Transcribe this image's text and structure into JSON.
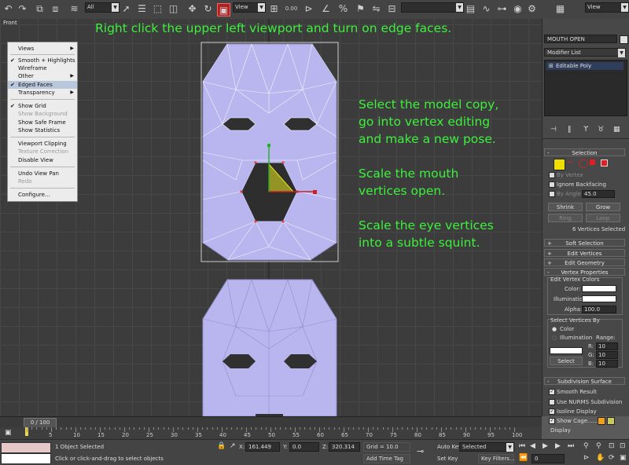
{
  "toolbar": {
    "selection_filter": "All",
    "ref_coord": "View",
    "ref_coord_2": "View",
    "spinner_value": "0.00",
    "icons": [
      "undo-icon",
      "redo-icon",
      "link-icon",
      "unlink-icon",
      "bind-space-warp-icon",
      "select-icon",
      "select-by-name-icon",
      "rect-select-icon",
      "window-crossing-icon",
      "move-icon",
      "rotate-icon",
      "scale-icon",
      "pivot-icon",
      "snap-icon",
      "angle-snap-icon",
      "percent-snap-icon",
      "spinner-snap-icon",
      "named-sets-icon",
      "mirror-icon",
      "align-icon",
      "layer-icon",
      "curve-editor-icon",
      "schematic-icon",
      "material-editor-icon",
      "render-setup-icon",
      "render-icon"
    ]
  },
  "viewport": {
    "label": "Front",
    "instructions": {
      "top": "Right click the upper left viewport and turn on edge faces.",
      "right": [
        "Select the model copy,",
        "go into vertex editing",
        "and make a new pose.",
        "",
        "Scale the mouth",
        "vertices open.",
        "",
        "Scale the eye vertices",
        "into a subtle squint."
      ]
    },
    "colors": {
      "face_fill": "#b9b6ef",
      "instruction_text": "#3cf03c",
      "gizmo_yellow": "#e8e820",
      "gizmo_red": "#cc2020",
      "gizmo_green": "#20b020"
    }
  },
  "context_menu": {
    "items": [
      {
        "label": "Views",
        "submenu": true
      },
      {
        "label": "Smooth + Highlights",
        "checked": true
      },
      {
        "label": "Wireframe"
      },
      {
        "label": "Other",
        "submenu": true
      },
      {
        "label": "Edged Faces",
        "checked": true,
        "highlighted": true
      },
      {
        "label": "Transparency",
        "submenu": true
      },
      {
        "label": "Show Grid",
        "checked": true
      },
      {
        "label": "Show Background",
        "disabled": true
      },
      {
        "label": "Show Safe Frame"
      },
      {
        "label": "Show Statistics"
      },
      {
        "label": "Viewport Clipping"
      },
      {
        "label": "Texture Correction",
        "disabled": true
      },
      {
        "label": "Disable View"
      },
      {
        "label": "Undo View Pan"
      },
      {
        "label": "Redo",
        "disabled": true
      },
      {
        "label": "Configure..."
      }
    ]
  },
  "panel": {
    "object_name": "MOUTH OPEN",
    "modifier_list": "Modifier List",
    "stack_item": "Editable Poly",
    "rollouts": {
      "selection": "Selection",
      "soft_selection": "Soft Selection",
      "edit_vertices": "Edit Vertices",
      "edit_geometry": "Edit Geometry",
      "vertex_properties": "Vertex Properties",
      "subdivision_surface": "Subdivision Surface"
    },
    "selection": {
      "by_vertex": "By Vertex",
      "ignore_backfacing": "Ignore Backfacing",
      "by_angle": "By Angle:",
      "by_angle_value": "45.0",
      "shrink": "Shrink",
      "grow": "Grow",
      "ring": "Ring",
      "loop": "Loop",
      "status": "6 Vertices Selected"
    },
    "vertex_properties": {
      "edit_colors": "Edit Vertex Colors",
      "color": "Color:",
      "illumination": "Illumination:",
      "alpha": "Alpha:",
      "alpha_value": "100.0",
      "select_by": "Select Vertices By",
      "select_color": "Color",
      "select_illumination": "Illumination",
      "range": "Range:",
      "r": "R:",
      "g": "G:",
      "b": "B:",
      "r_value": "10",
      "g_value": "10",
      "b_value": "10",
      "select_button": "Select"
    },
    "subdivision": {
      "smooth_result": "Smooth Result",
      "use_nurms": "Use NURMS Subdivision",
      "isoline": "Isoline Display",
      "show_cage": "Show Cage......",
      "display": "Display"
    }
  },
  "timeline": {
    "frame": "0 / 100",
    "ticks": [
      "5",
      "10",
      "15",
      "20",
      "25",
      "30",
      "35",
      "40",
      "45",
      "50",
      "55",
      "60",
      "65",
      "70",
      "75",
      "80",
      "85",
      "90",
      "95",
      "100"
    ]
  },
  "status": {
    "selected": "1 Object Selected",
    "prompt": "Click or click-and-drag to select objects",
    "x_label": "X:",
    "x_value": "161.449",
    "y_label": "Y:",
    "y_value": "0.0",
    "z_label": "Z:",
    "z_value": "320.314",
    "grid": "Grid = 10.0",
    "add_time_tag": "Add Time Tag",
    "auto_key": "Auto Key",
    "set_key": "Set Key",
    "key_mode": "Selected",
    "key_filters": "Key Filters...",
    "frame_value": "0"
  }
}
